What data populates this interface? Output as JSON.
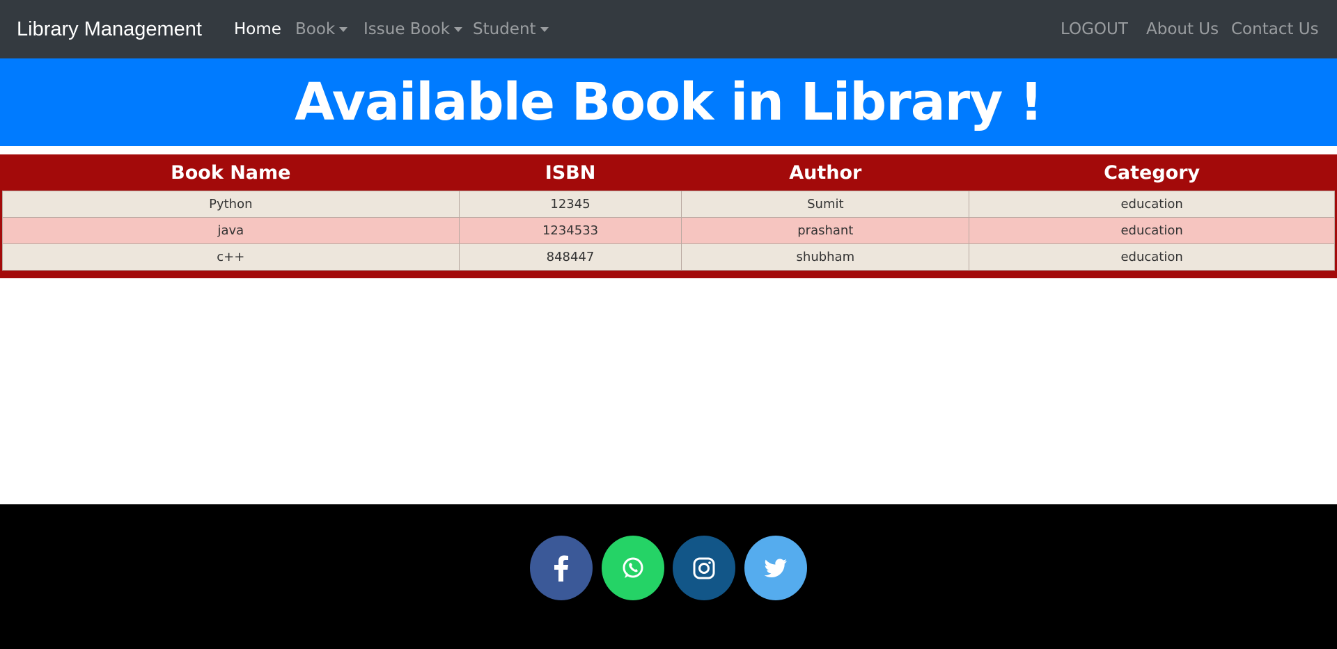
{
  "navbar": {
    "brand": "Library Management",
    "items": [
      {
        "label": "Home",
        "active": true,
        "dropdown": false
      },
      {
        "label": "Book",
        "active": false,
        "dropdown": true
      },
      {
        "label": "Issue Book",
        "active": false,
        "dropdown": true
      },
      {
        "label": "Student",
        "active": false,
        "dropdown": true
      }
    ],
    "right_items": [
      {
        "label": "LOGOUT"
      },
      {
        "label": "About Us"
      },
      {
        "label": "Contact Us"
      }
    ]
  },
  "banner": {
    "title": "Available Book in Library !"
  },
  "table": {
    "headers": [
      "Book Name",
      "ISBN",
      "Author",
      "Category"
    ],
    "rows": [
      [
        "Python",
        "12345",
        "Sumit",
        "education"
      ],
      [
        "java",
        "1234533",
        "prashant",
        "education"
      ],
      [
        "c++",
        "848447",
        "shubham",
        "education"
      ]
    ]
  },
  "footer": {
    "social": [
      {
        "name": "facebook-icon",
        "color": "#3b5998"
      },
      {
        "name": "whatsapp-icon",
        "color": "#25d366"
      },
      {
        "name": "instagram-icon",
        "color": "#125688"
      },
      {
        "name": "twitter-icon",
        "color": "#55acee"
      }
    ]
  },
  "colors": {
    "navbar": "#343a40",
    "banner": "#007bff",
    "table_bg": "#a30a0a",
    "row_odd": "#ede6dc",
    "row_even": "#f6c5c0",
    "footer": "#000000"
  }
}
